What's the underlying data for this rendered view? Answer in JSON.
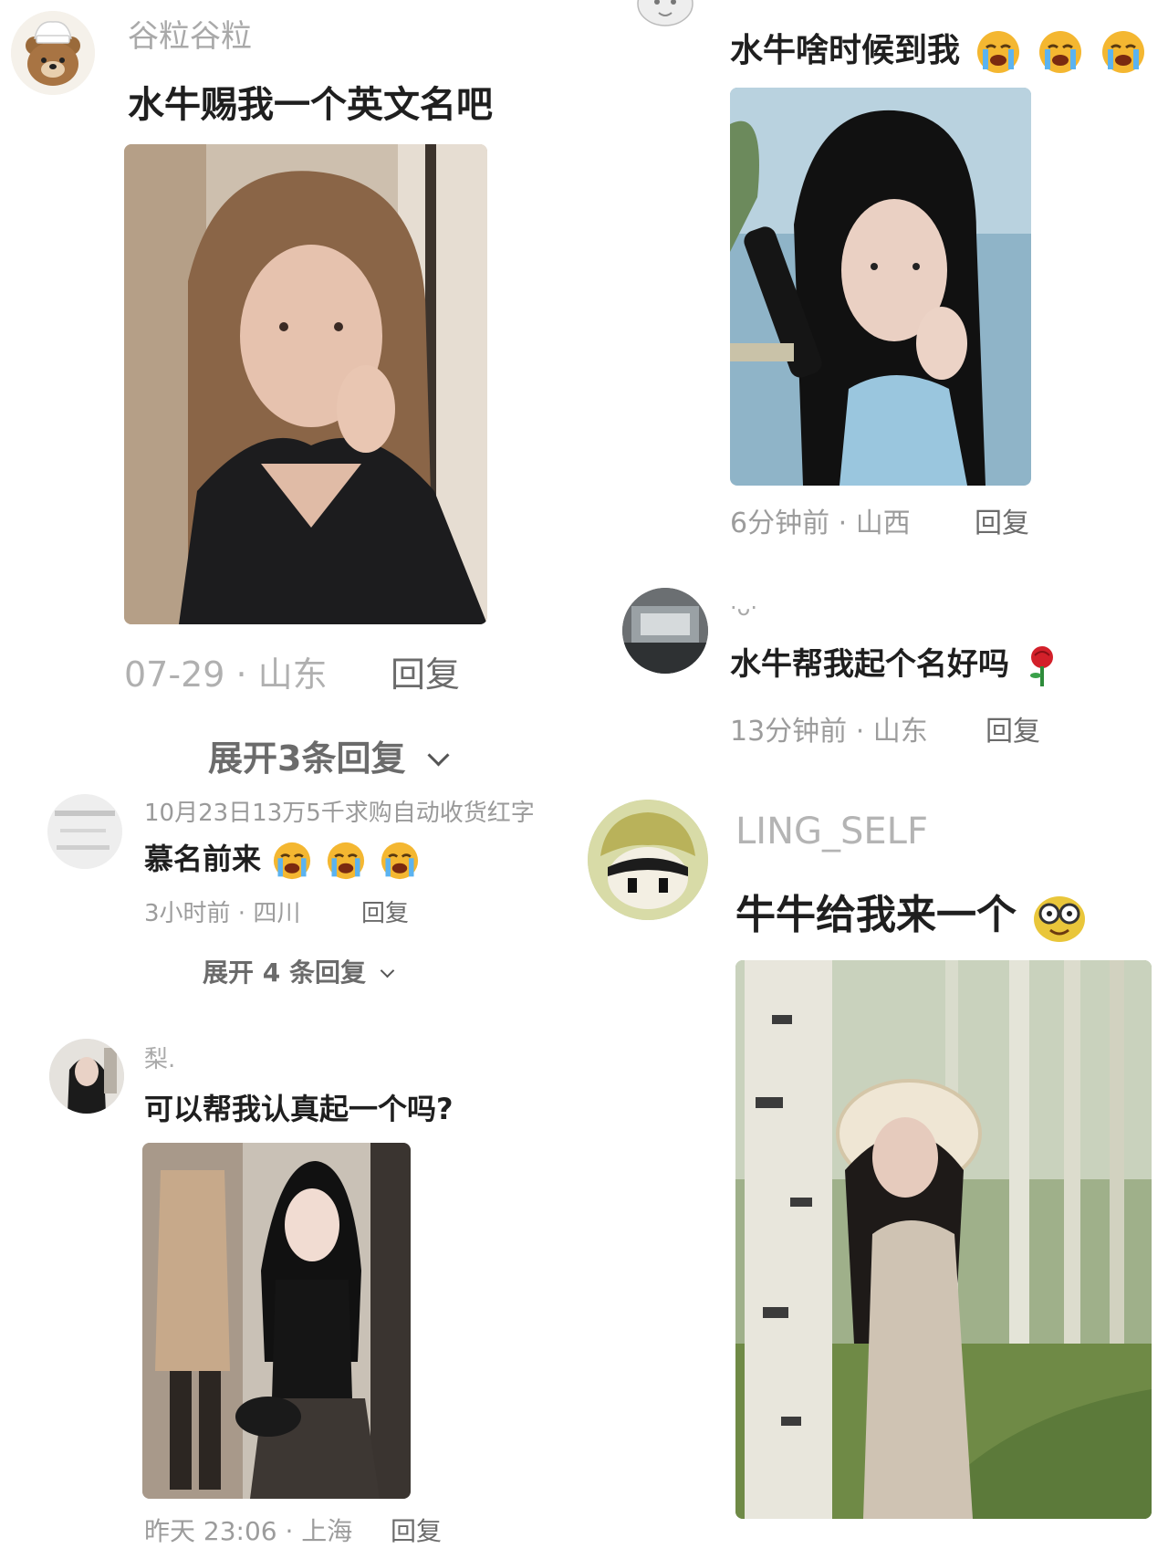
{
  "comments": {
    "c1": {
      "username": "谷粒谷粒",
      "text": "水牛赐我一个英文名吧",
      "meta": "07-29 · 山东",
      "reply": "回复",
      "expand": "展开3条回复"
    },
    "c2": {
      "text": "水牛啥时候到我",
      "meta": "6分钟前 · 山西",
      "reply": "回复"
    },
    "c3": {
      "username": "·ᴗ·",
      "text": "水牛帮我起个名好吗",
      "meta": "13分钟前 · 山东",
      "reply": "回复"
    },
    "c4": {
      "username": "10月23日13万5千求购自动收货红字",
      "text": "慕名前来",
      "meta": "3小时前 · 四川",
      "reply": "回复",
      "expand": "展开 4 条回复"
    },
    "c5": {
      "username": "LING_SELF",
      "text": "牛牛给我来一个"
    },
    "c6": {
      "username": "梨.",
      "text": "可以帮我认真起一个吗?",
      "meta": "昨天 23:06 · 上海",
      "reply": "回复"
    }
  },
  "icons": {
    "cry_emoji": "loudly-crying-face",
    "glasses_emoji": "nerd-face",
    "rose_emoji": "rose",
    "chevron": "chevron-down"
  },
  "colors": {
    "meta_gray": "#9c9c9c",
    "text_dark": "#1f1f1f",
    "emoji_yellow": "#f4b731"
  }
}
